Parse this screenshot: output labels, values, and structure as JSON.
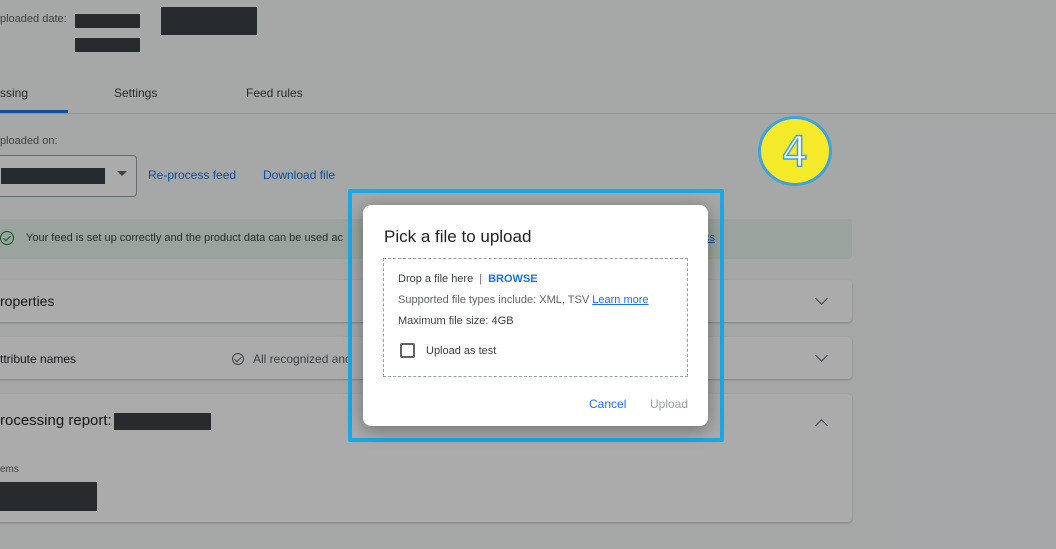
{
  "header": {
    "uploaded_date_label": "ploaded date:"
  },
  "tabs": [
    {
      "label": "ssing",
      "active": true
    },
    {
      "label": "Settings",
      "active": false
    },
    {
      "label": "Feed rules",
      "active": false
    }
  ],
  "uploaded_on_label": "ploaded on:",
  "actions": {
    "reprocess": "Re-process feed",
    "download": "Download file"
  },
  "banner": {
    "text": "Your feed is set up correctly and the product data can be used ac",
    "link_fragment": "cs"
  },
  "panels": {
    "properties": "roperties",
    "attributes": "ttribute names",
    "attributes_status": "All recognized and",
    "processing_report": "rocessing report:",
    "items_label": "ems"
  },
  "step_badge": "4",
  "dialog": {
    "title": "Pick a file to upload",
    "drop_text": "Drop a file here",
    "separator": "|",
    "browse": "BROWSE",
    "supported": "Supported file types include: XML, TSV",
    "learn_more": "Learn more",
    "max_size": "Maximum file size: 4GB",
    "upload_test_label": "Upload as test",
    "cancel": "Cancel",
    "upload": "Upload"
  },
  "colors": {
    "accent": "#1a73e8",
    "highlight": "#1aa9e6",
    "badge_fill": "#f4ea2a",
    "success": "#188038"
  }
}
